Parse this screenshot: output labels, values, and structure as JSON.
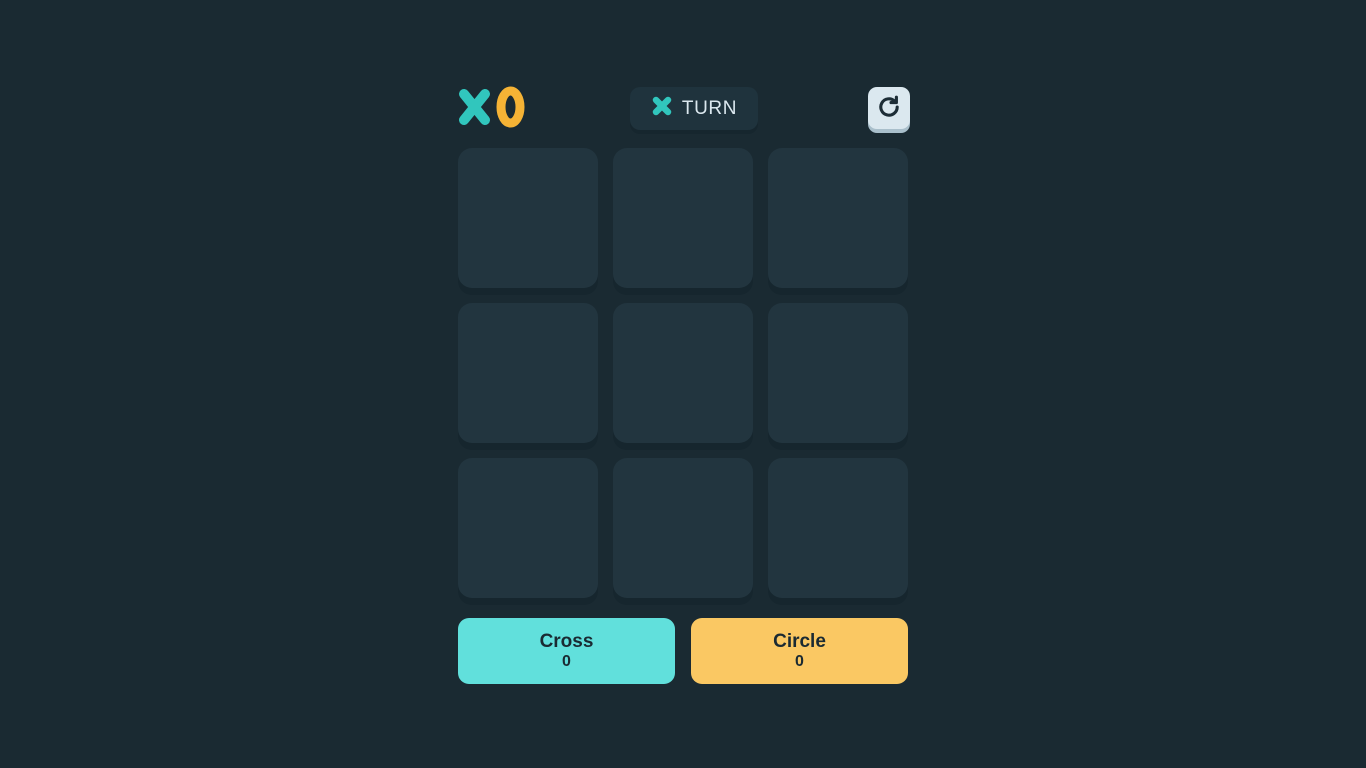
{
  "theme": {
    "background": "#1a2a32",
    "cell_bg": "#22353f",
    "cell_shadow": "#16262e",
    "cross_color": "#31c6bd",
    "circle_color": "#f5b335",
    "cross_panel": "#61e0dc",
    "circle_panel": "#fac863",
    "light_button": "#dbe8ef",
    "text_light": "#dbe8ef",
    "text_dark": "#1a2a32"
  },
  "header": {
    "logo": {
      "x_glyph": "X",
      "o_glyph": "O",
      "x_icon": "cross-icon",
      "o_icon": "circle-icon"
    },
    "turn": {
      "label": "TURN",
      "marker_icon": "cross-icon",
      "current_player": "cross"
    },
    "restart": {
      "icon": "restart-icon",
      "label": "Restart"
    }
  },
  "board": {
    "cells": [
      {
        "index": 0,
        "value": ""
      },
      {
        "index": 1,
        "value": ""
      },
      {
        "index": 2,
        "value": ""
      },
      {
        "index": 3,
        "value": ""
      },
      {
        "index": 4,
        "value": ""
      },
      {
        "index": 5,
        "value": ""
      },
      {
        "index": 6,
        "value": ""
      },
      {
        "index": 7,
        "value": ""
      },
      {
        "index": 8,
        "value": ""
      }
    ]
  },
  "scores": [
    {
      "name": "cross",
      "title": "Cross",
      "value": "0"
    },
    {
      "name": "circle",
      "title": "Circle",
      "value": "0"
    }
  ]
}
